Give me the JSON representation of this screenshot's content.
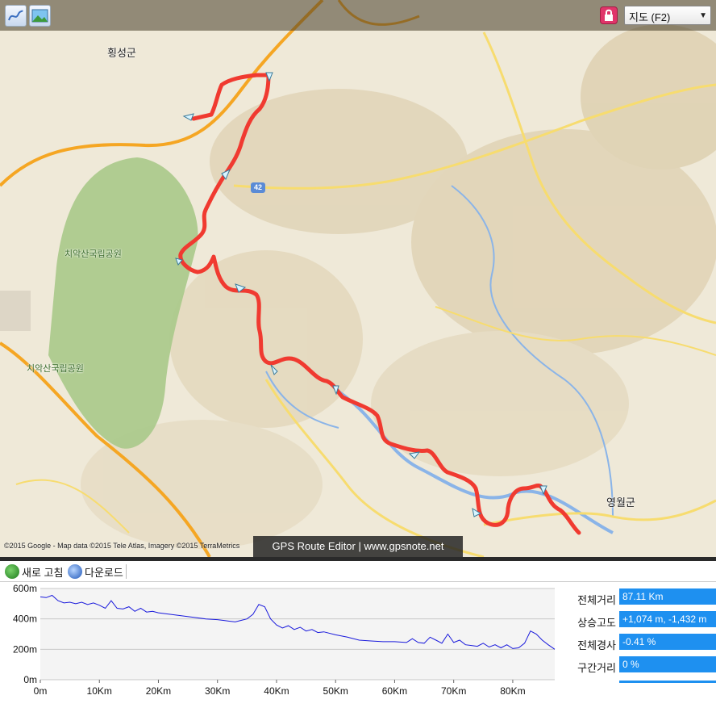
{
  "toolbar": {
    "track_tool_icon": "track-graph-icon",
    "photo_tool_icon": "photo-icon",
    "lock_icon": "lock-icon",
    "map_type_selected": "지도 (F2)"
  },
  "map": {
    "labels": {
      "hoengseong": "횡성군",
      "chiak_park_1": "치악산국립공원",
      "chiak_park_2": "치악산국립공원",
      "yeongwol": "영월군",
      "route_42": "42"
    },
    "attribution": "©2015 Google - Map data ©2015 Tele Atlas, Imagery ©2015 TerraMetrics",
    "brand": "GPS Route Editor | www.gpsnote.net",
    "colors": {
      "route": "#f03a30",
      "park": "#a9c98a",
      "road_major": "#f5a623",
      "road_minor": "#f7dc6f",
      "river": "#8ab4e8"
    }
  },
  "panel": {
    "refresh_label": "새로 고침",
    "download_label": "다운로드"
  },
  "stats": {
    "total_distance_label": "전체거리",
    "total_distance_value": "87.11 Km",
    "elevation_gain_label": "상승고도",
    "elevation_gain_value": "+1,074 m, -1,432 m",
    "avg_grade_label": "전체경사",
    "avg_grade_value": "-0.41 %",
    "segment_distance_label": "구간거리",
    "segment_distance_value": "0 %"
  },
  "chart_data": {
    "type": "line",
    "title": "",
    "xlabel": "",
    "ylabel": "",
    "x_ticks": [
      "0m",
      "10Km",
      "20Km",
      "30Km",
      "40Km",
      "50Km",
      "60Km",
      "70Km",
      "80Km"
    ],
    "y_ticks": [
      "0m",
      "200m",
      "400m",
      "600m"
    ],
    "xlim": [
      0,
      87.11
    ],
    "ylim": [
      0,
      600
    ],
    "grid": true,
    "series": [
      {
        "color": "#1a1adc",
        "x": [
          0,
          1,
          2,
          3,
          4,
          5,
          6,
          7,
          8,
          9,
          10,
          11,
          12,
          13,
          14,
          15,
          16,
          17,
          18,
          19,
          20,
          22,
          24,
          26,
          28,
          30,
          31,
          32,
          33,
          34,
          35,
          36,
          37,
          38,
          39,
          40,
          41,
          42,
          43,
          44,
          45,
          46,
          47,
          48,
          50,
          52,
          54,
          56,
          58,
          60,
          62,
          63,
          64,
          65,
          66,
          67,
          68,
          69,
          70,
          71,
          72,
          73,
          74,
          75,
          76,
          77,
          78,
          79,
          80,
          81,
          82,
          83,
          84,
          85,
          86,
          87.11
        ],
        "y": [
          545,
          540,
          555,
          520,
          505,
          510,
          500,
          510,
          495,
          505,
          490,
          470,
          520,
          470,
          465,
          480,
          450,
          470,
          445,
          450,
          440,
          430,
          420,
          410,
          400,
          395,
          390,
          385,
          380,
          390,
          400,
          430,
          495,
          480,
          400,
          360,
          340,
          355,
          330,
          345,
          320,
          330,
          310,
          315,
          295,
          280,
          260,
          255,
          250,
          250,
          245,
          270,
          245,
          240,
          280,
          260,
          240,
          300,
          245,
          260,
          230,
          225,
          220,
          240,
          215,
          230,
          210,
          230,
          205,
          210,
          240,
          320,
          300,
          260,
          230,
          200
        ]
      }
    ]
  }
}
